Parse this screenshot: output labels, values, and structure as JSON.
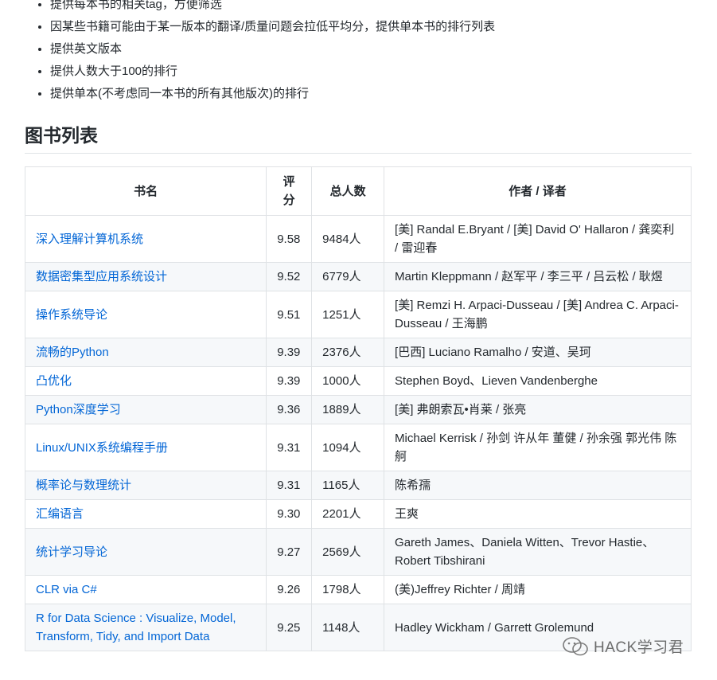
{
  "bullets": [
    "提供每本书的相关tag，方便筛选",
    "因某些书籍可能由于某一版本的翻译/质量问题会拉低平均分，提供单本书的排行列表",
    "提供英文版本",
    "提供人数大于100的排行",
    "提供单本(不考虑同一本书的所有其他版次)的排行"
  ],
  "section_title": "图书列表",
  "table": {
    "headers": {
      "name": "书名",
      "score": "评分",
      "count": "总人数",
      "author": "作者 / 译者"
    },
    "rows": [
      {
        "name": "深入理解计算机系统",
        "score": "9.58",
        "count": "9484人",
        "author": "[美] Randal E.Bryant / [美] David O' Hallaron / 龚奕利 / 雷迎春"
      },
      {
        "name": "数据密集型应用系统设计",
        "score": "9.52",
        "count": "6779人",
        "author": "Martin Kleppmann / 赵军平 / 李三平 / 吕云松 / 耿煜"
      },
      {
        "name": "操作系统导论",
        "score": "9.51",
        "count": "1251人",
        "author": "[美] Remzi H. Arpaci-Dusseau / [美] Andrea C. Arpaci-Dusseau / 王海鹏"
      },
      {
        "name": "流畅的Python",
        "score": "9.39",
        "count": "2376人",
        "author": "[巴西] Luciano Ramalho / 安道、吴珂"
      },
      {
        "name": "凸优化",
        "score": "9.39",
        "count": "1000人",
        "author": "Stephen Boyd、Lieven Vandenberghe"
      },
      {
        "name": "Python深度学习",
        "score": "9.36",
        "count": "1889人",
        "author": "[美] 弗朗索瓦•肖莱 / 张亮"
      },
      {
        "name": "Linux/UNIX系统编程手册",
        "score": "9.31",
        "count": "1094人",
        "author": "Michael Kerrisk / 孙剑 许从年 董健 / 孙余强 郭光伟 陈舸"
      },
      {
        "name": "概率论与数理统计",
        "score": "9.31",
        "count": "1165人",
        "author": "陈希孺"
      },
      {
        "name": "汇编语言",
        "score": "9.30",
        "count": "2201人",
        "author": "王爽"
      },
      {
        "name": "统计学习导论",
        "score": "9.27",
        "count": "2569人",
        "author": "Gareth James、Daniela Witten、Trevor Hastie、Robert Tibshirani"
      },
      {
        "name": "CLR via C#",
        "score": "9.26",
        "count": "1798人",
        "author": "(美)Jeffrey Richter / 周靖"
      },
      {
        "name": "R for Data Science : Visualize, Model, Transform, Tidy, and Import Data",
        "score": "9.25",
        "count": "1148人",
        "author": "Hadley Wickham / Garrett Grolemund"
      }
    ]
  },
  "watermark": "HACK学习君",
  "colors": {
    "link": "#0366d6",
    "border": "#dfe2e5",
    "stripe": "#f6f8fa",
    "text": "#24292e"
  }
}
